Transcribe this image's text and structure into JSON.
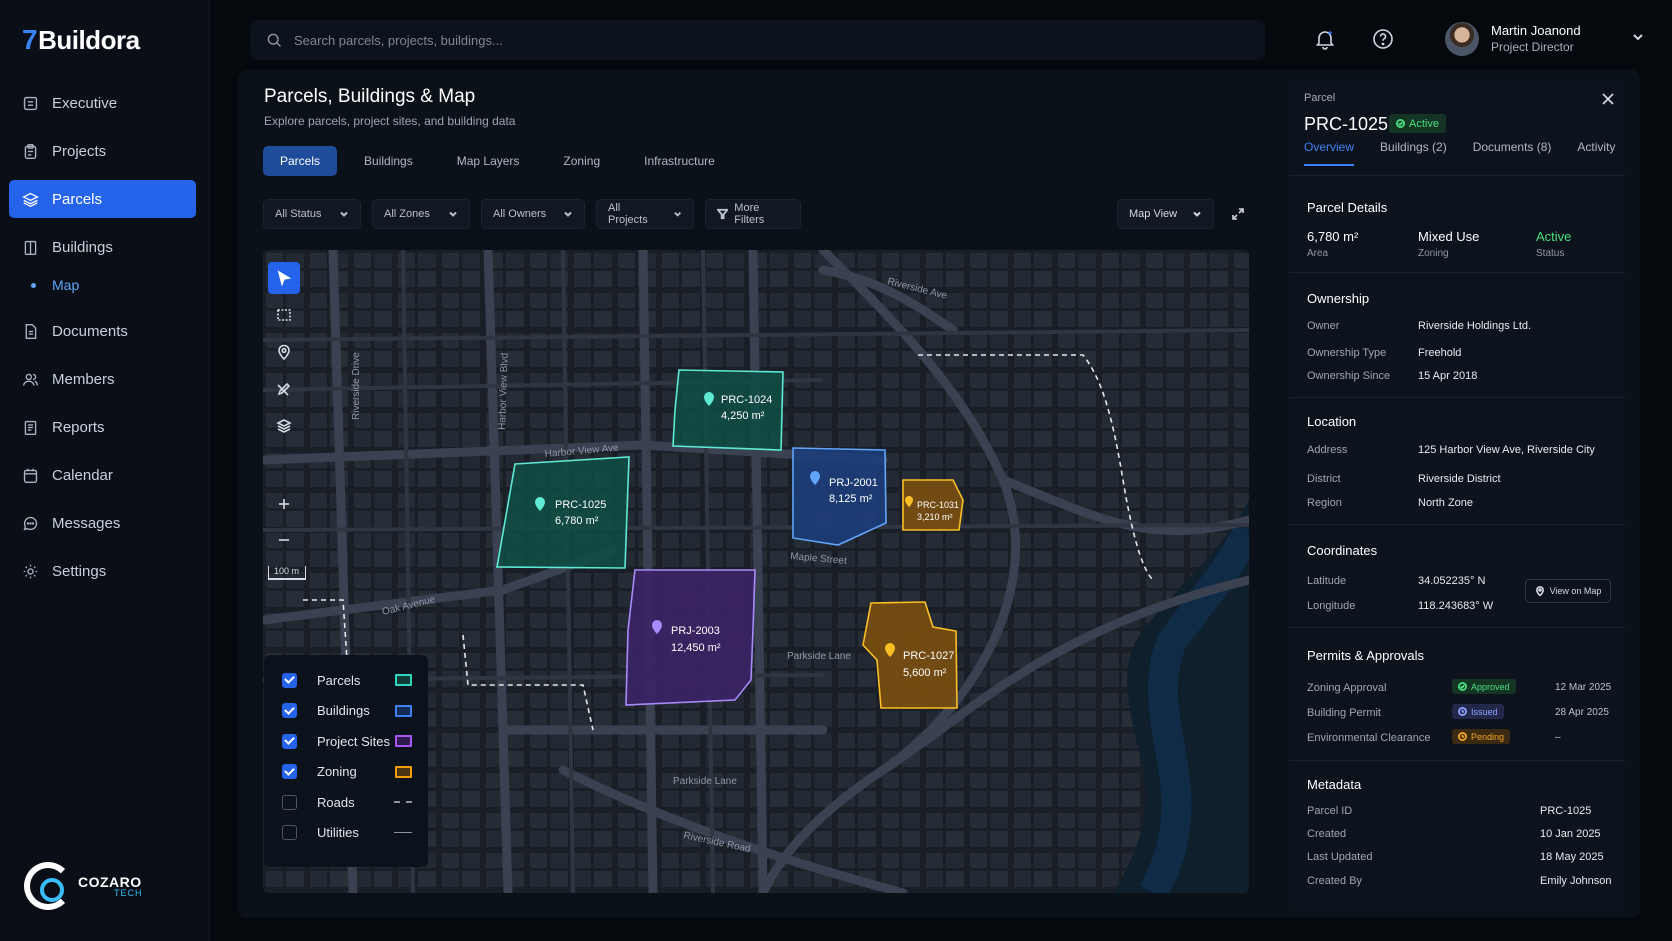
{
  "brand": {
    "name": "Buildora"
  },
  "sidebar": {
    "items": [
      {
        "label": "Executive"
      },
      {
        "label": "Projects"
      },
      {
        "label": "Parcels"
      },
      {
        "label": "Buildings"
      },
      {
        "label": "Map"
      },
      {
        "label": "Documents"
      },
      {
        "label": "Members"
      },
      {
        "label": "Reports"
      },
      {
        "label": "Calendar"
      },
      {
        "label": "Messages"
      },
      {
        "label": "Settings"
      }
    ],
    "active": "Parcels",
    "footer": {
      "logo_name": "COZARO",
      "logo_sub": "TECH"
    }
  },
  "search": {
    "placeholder": "Search parcels, projects, buildings..."
  },
  "user": {
    "name": "Martin Joanond",
    "role": "Project Director"
  },
  "page": {
    "title": "Parcels, Buildings & Map",
    "subtitle": "Explore parcels, project sites, and building data",
    "tabs": [
      {
        "label": "Parcels"
      },
      {
        "label": "Buildings"
      },
      {
        "label": "Map Layers"
      },
      {
        "label": "Zoning"
      },
      {
        "label": "Infrastructure"
      }
    ],
    "active_tab": "Parcels",
    "filters": [
      {
        "label": "All Status"
      },
      {
        "label": "All Zones"
      },
      {
        "label": "All Owners"
      },
      {
        "label": "All Projects"
      }
    ],
    "more_filters": "More Filters",
    "view_mode": "Map View"
  },
  "map": {
    "streets": {
      "riverside_ave": "Riverside Ave",
      "riverside_drive": "Riverside Drive",
      "harbor_view_blvd": "Harbor View Blvd",
      "harbor_view_ave": "Harbor View Ave",
      "maple_street": "Maple Street",
      "oak_avenue": "Oak Avenue",
      "parkside_lane_1": "Parkside Lane",
      "parkside_lane_2": "Parkside Lane",
      "riverside_road": "Riverside Road"
    },
    "scale": "100 m",
    "parcels": [
      {
        "id": "PRC-1024",
        "area": "4,250 m²",
        "layer": "parcels"
      },
      {
        "id": "PRC-1025",
        "area": "6,780 m²",
        "layer": "parcels"
      },
      {
        "id": "PRJ-2001",
        "area": "8,125 m²",
        "layer": "buildings"
      },
      {
        "id": "PRC-1031",
        "area": "3,210 m²",
        "layer": "zoning"
      },
      {
        "id": "PRJ-2003",
        "area": "12,450 m²",
        "layer": "project_sites"
      },
      {
        "id": "PRC-1027",
        "area": "5,600 m²",
        "layer": "zoning"
      }
    ],
    "legend": [
      {
        "label": "Parcels",
        "checked": true,
        "color": "#2dd4bf"
      },
      {
        "label": "Buildings",
        "checked": true,
        "color": "#3b82f6"
      },
      {
        "label": "Project Sites",
        "checked": true,
        "color": "#a855f7"
      },
      {
        "label": "Zoning",
        "checked": true,
        "color": "#f59e0b"
      },
      {
        "label": "Roads",
        "checked": false
      },
      {
        "label": "Utilities",
        "checked": false
      }
    ]
  },
  "detail": {
    "kicker": "Parcel",
    "id": "PRC-1025",
    "status": "Active",
    "tabs": [
      {
        "label": "Overview"
      },
      {
        "label": "Buildings (2)"
      },
      {
        "label": "Documents (8)"
      },
      {
        "label": "Activity"
      }
    ],
    "parcel_details": {
      "title": "Parcel Details",
      "area": {
        "value": "6,780 m²",
        "label": "Area"
      },
      "zoning": {
        "value": "Mixed Use",
        "label": "Zoning"
      },
      "status": {
        "value": "Active",
        "label": "Status"
      }
    },
    "ownership": {
      "title": "Ownership",
      "rows": [
        {
          "k": "Owner",
          "v": "Riverside Holdings Ltd."
        },
        {
          "k": "Ownership Type",
          "v": "Freehold"
        },
        {
          "k": "Ownership Since",
          "v": "15 Apr 2018"
        }
      ]
    },
    "location": {
      "title": "Location",
      "rows": [
        {
          "k": "Address",
          "v": "125 Harbor View Ave, Riverside City"
        },
        {
          "k": "District",
          "v": "Riverside District"
        },
        {
          "k": "Region",
          "v": "North Zone"
        }
      ]
    },
    "coordinates": {
      "title": "Coordinates",
      "rows": [
        {
          "k": "Latitude",
          "v": "34.052235° N"
        },
        {
          "k": "Longitude",
          "v": "118.243683° W"
        }
      ],
      "button": "View on Map"
    },
    "permits": {
      "title": "Permits & Approvals",
      "rows": [
        {
          "k": "Zoning Approval",
          "badge": "Approved",
          "date": "12 Mar 2025"
        },
        {
          "k": "Building Permit",
          "badge": "Issued",
          "date": "28 Apr 2025"
        },
        {
          "k": "Environmental Clearance",
          "badge": "Pending",
          "date": "–"
        }
      ]
    },
    "metadata": {
      "title": "Metadata",
      "rows": [
        {
          "k": "Parcel ID",
          "v": "PRC-1025"
        },
        {
          "k": "Created",
          "v": "10 Jan 2025"
        },
        {
          "k": "Last Updated",
          "v": "18 May 2025"
        },
        {
          "k": "Created By",
          "v": "Emily Johnson"
        }
      ]
    }
  }
}
